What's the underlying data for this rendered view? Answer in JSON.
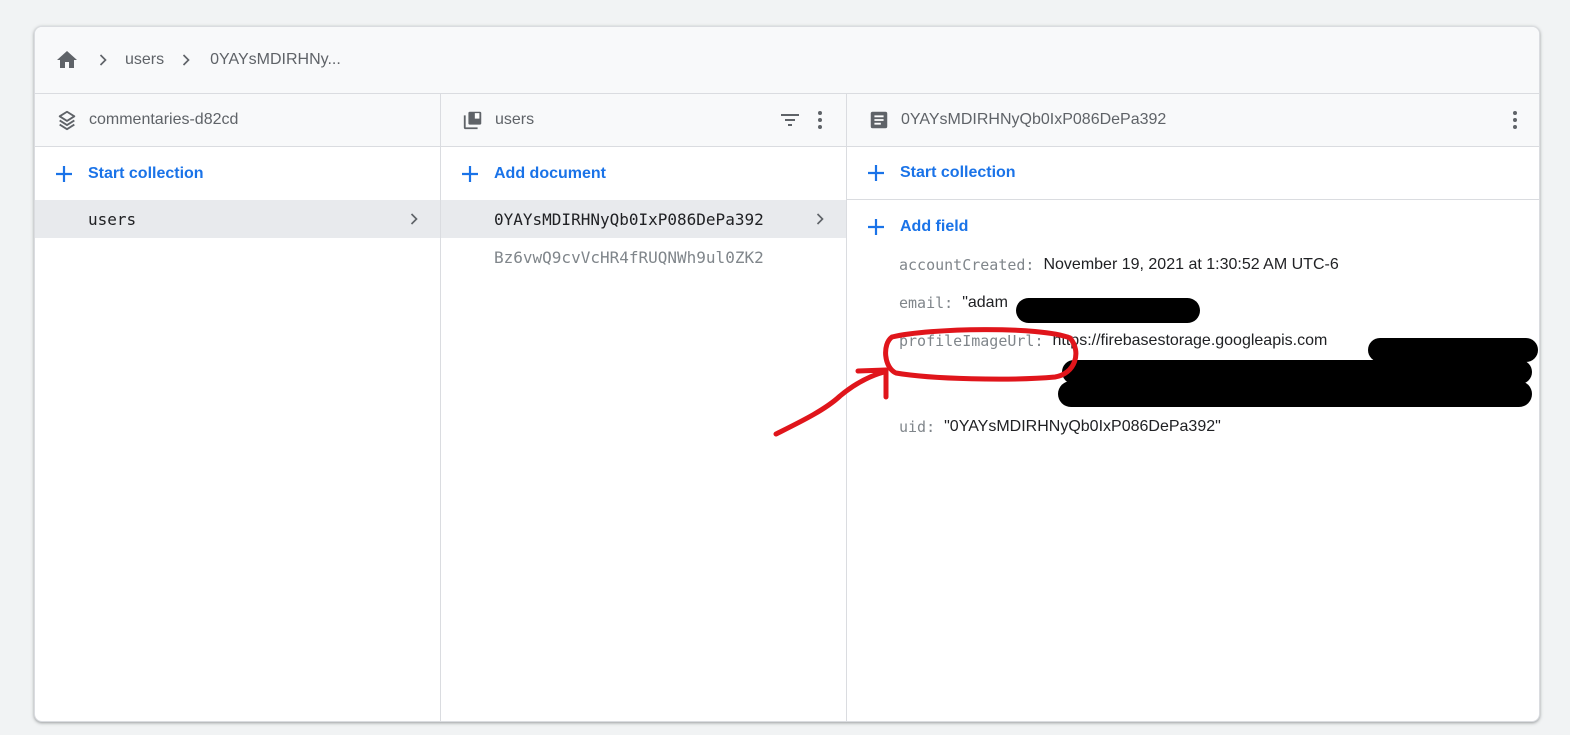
{
  "breadcrumb": {
    "home_icon": "home-icon",
    "items": [
      "users",
      "0YAYsMDIRHNy..."
    ]
  },
  "columns": {
    "project": {
      "title": "commentaries-d82cd",
      "icon": "firestore-stack-icon",
      "action_label": "Start collection",
      "items": [
        {
          "label": "users",
          "selected": true
        }
      ]
    },
    "collection": {
      "title": "users",
      "icon": "collection-icon",
      "action_label": "Add document",
      "items": [
        {
          "label": "0YAYsMDIRHNyQb0IxP086DePa392",
          "selected": true
        },
        {
          "label": "Bz6vwQ9cvVcHR4fRUQNWh9ul0ZK2",
          "selected": false
        }
      ]
    },
    "document": {
      "title": "0YAYsMDIRHNyQb0IxP086DePa392",
      "icon": "document-icon",
      "start_collection_label": "Start collection",
      "add_field_label": "Add field",
      "fields": [
        {
          "key": "accountCreated:",
          "value": "November 19, 2021 at 1:30:52 AM UTC-6"
        },
        {
          "key": "email:",
          "value": "\"adam"
        },
        {
          "key": "profileImageUrl:",
          "value": "https://firebasestorage.googleapis.com"
        },
        {
          "key": "uid:",
          "value": "\"0YAYsMDIRHNyQb0IxP086DePa392\""
        }
      ]
    }
  },
  "colors": {
    "accent": "#1a73e8",
    "annotation": "#e0151b",
    "redaction": "#000000"
  }
}
